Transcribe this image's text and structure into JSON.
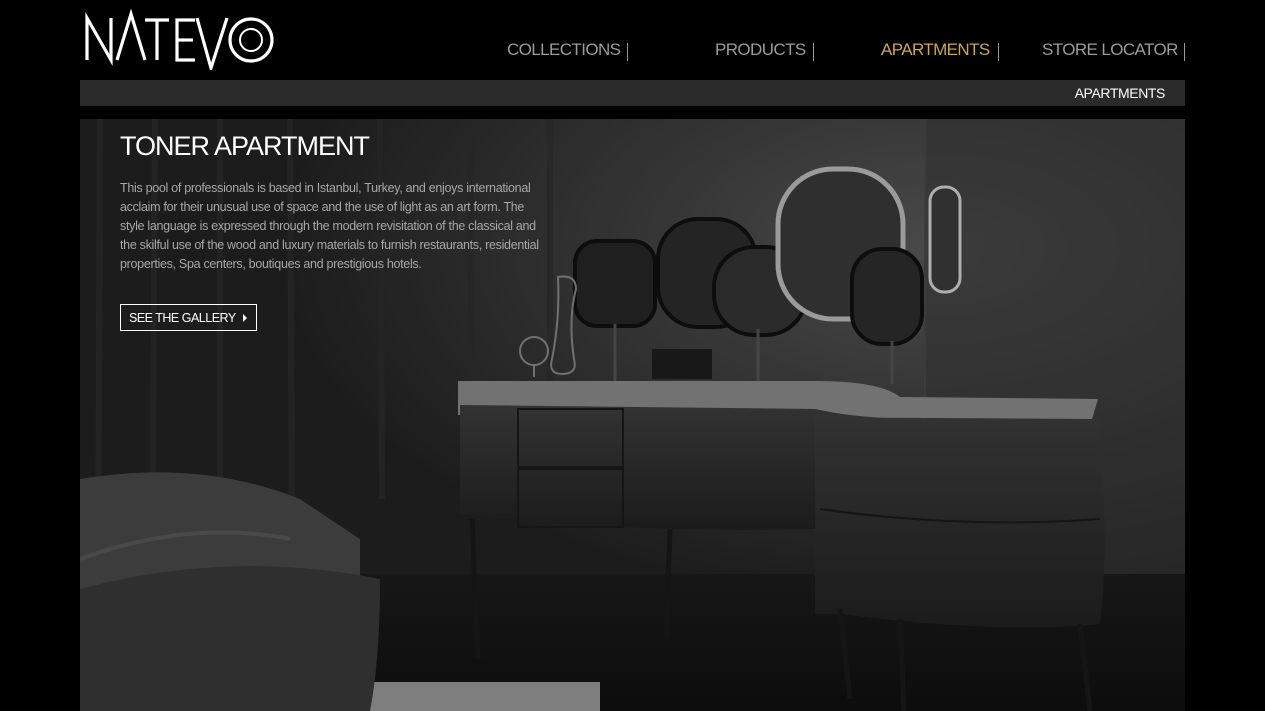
{
  "brand": {
    "logo_text": "NATEVO"
  },
  "nav": {
    "items": [
      {
        "label": "COLLECTIONS"
      },
      {
        "label": "PRODUCTS"
      },
      {
        "label": "APARTMENTS",
        "active": true
      },
      {
        "label": "STORE LOCATOR"
      }
    ],
    "active_color": "#c9a94e",
    "inactive_color": "#9b9b9b"
  },
  "breadcrumb": {
    "current": "APARTMENTS"
  },
  "hero": {
    "title": "TONER APARTMENT",
    "description": "This pool of professionals is based in Istanbul, Turkey, and enjoys international acclaim for their unusual use of space and the use of light as an art form. The style language is expressed through the modern revisitation of the classical and the skilful use of the wood and luxury materials to furnish restaurants, residential properties, Spa centers, boutiques and prestigious hotels.",
    "button_label": "SEE THE GALLERY",
    "button_icon": "chevron-right-icon"
  }
}
